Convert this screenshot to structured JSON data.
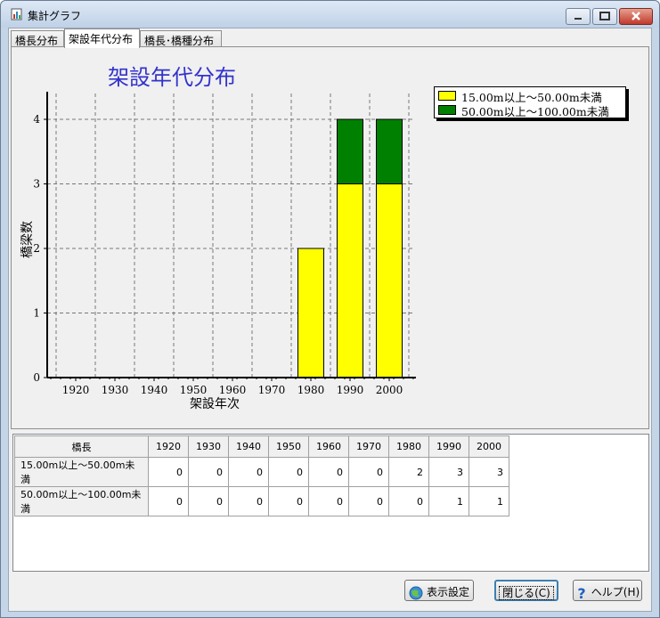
{
  "window": {
    "title": "集計グラフ"
  },
  "tabs": [
    {
      "label": "橋長分布",
      "active": false
    },
    {
      "label": "架設年代分布",
      "active": true
    },
    {
      "label": "橋長･橋種分布",
      "active": false
    }
  ],
  "chart_data": {
    "type": "bar",
    "stacked": true,
    "title": "架設年代分布",
    "xlabel": "架設年次",
    "ylabel": "橋梁数",
    "categories": [
      "1920",
      "1930",
      "1940",
      "1950",
      "1960",
      "1970",
      "1980",
      "1990",
      "2000"
    ],
    "series": [
      {
        "name": "15.00m以上～50.00m未満",
        "color": "#ffff00",
        "values": [
          0,
          0,
          0,
          0,
          0,
          0,
          2,
          3,
          3
        ]
      },
      {
        "name": "50.00m以上～100.00m未満",
        "color": "#008000",
        "values": [
          0,
          0,
          0,
          0,
          0,
          0,
          0,
          1,
          1
        ]
      }
    ],
    "ylim": [
      0,
      4.4
    ],
    "yticks": [
      "0",
      "1",
      "2",
      "3",
      "4"
    ],
    "grid": true,
    "legend": "top-right",
    "title_color": "#3333cc"
  },
  "table": {
    "corner": "橋長",
    "columns": [
      "1920",
      "1930",
      "1940",
      "1950",
      "1960",
      "1970",
      "1980",
      "1990",
      "2000"
    ],
    "rows": [
      {
        "label": "15.00m以上～50.00m未満",
        "values": [
          "0",
          "0",
          "0",
          "0",
          "0",
          "0",
          "2",
          "3",
          "3"
        ]
      },
      {
        "label": "50.00m以上～100.00m未満",
        "values": [
          "0",
          "0",
          "0",
          "0",
          "0",
          "0",
          "0",
          "1",
          "1"
        ]
      }
    ]
  },
  "buttons": {
    "display_settings": "表示設定",
    "close": "閉じる(C)",
    "help": "ヘルプ(H)"
  }
}
